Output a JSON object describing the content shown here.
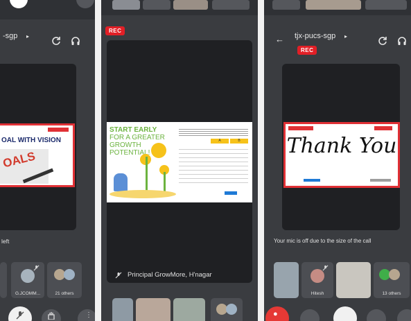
{
  "left_panel": {
    "meeting_title": "-sgp",
    "slide_heading": "OAL WITH VISION",
    "slide_scribble": "OALS",
    "caption": "left",
    "tiles": [
      {
        "label": "G.JCOMM..."
      },
      {
        "label": "21 others"
      }
    ]
  },
  "middle_panel": {
    "rec_badge": "REC",
    "slide": {
      "headline_lines": [
        "START EARLY",
        "FOR A GREATER",
        "GROWTH",
        "POTENTIAL!"
      ],
      "col_headers": [
        "A",
        "B"
      ]
    },
    "presenter": "Principal GrowMore, H'nagar"
  },
  "right_panel": {
    "meeting_title": "tjx-pucs-sgp",
    "rec_badge": "REC",
    "slide_text": "Thank You",
    "caption": "Your mic is off due to the size of the call",
    "tiles": [
      {
        "label": "Hitesh"
      },
      {
        "label": "13 others"
      }
    ]
  },
  "colors": {
    "panel_bg": "#3a3c40",
    "video_bg": "#1f2023",
    "rec_red": "#e21f26",
    "slide_border": "#e03035",
    "end_call_red": "#e53935",
    "avatar_green": "#3fae49"
  },
  "icons": {
    "header": [
      "camera-flip-icon",
      "headphones-icon",
      "back-arrow-icon"
    ],
    "controls": [
      "mic-off-icon",
      "end-call-icon",
      "hand-icon",
      "more-icon"
    ]
  }
}
